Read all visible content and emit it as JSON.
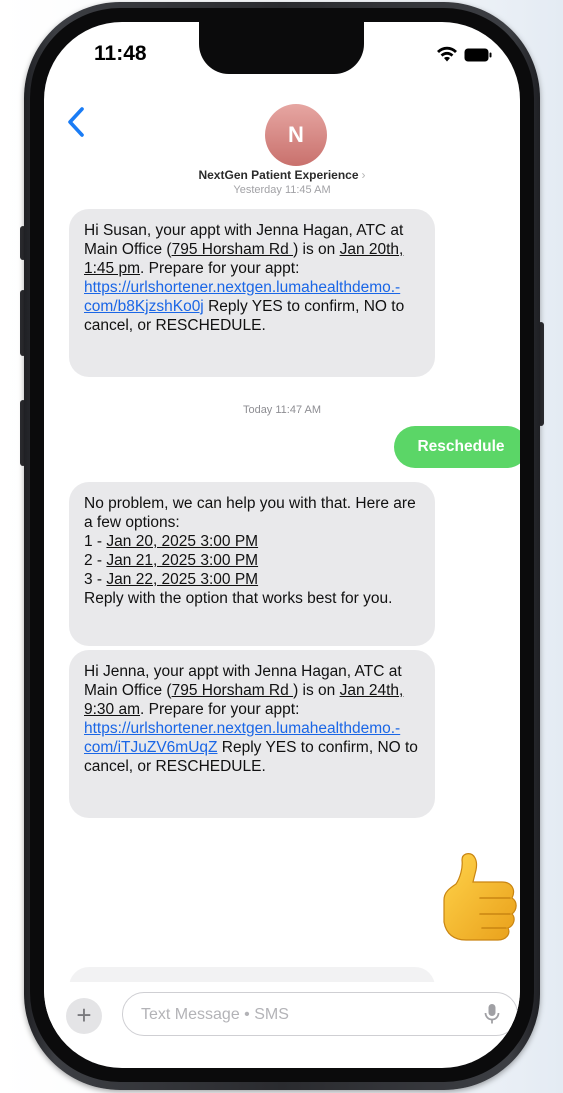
{
  "status_bar": {
    "time": "11:48",
    "icons": [
      "wifi-icon",
      "battery-icon"
    ]
  },
  "header": {
    "back_icon": "chevron-left-icon",
    "avatar_initial": "N",
    "contact_name": "NextGen Patient Experience",
    "contact_chevron": "›"
  },
  "timestamps": {
    "yesterday": "Yesterday 11:45 AM",
    "today": "Today 11:47 AM"
  },
  "messages": [
    {
      "direction": "incoming",
      "segments": [
        {
          "t": "Hi Susan, your appt with Jenna Hagan, ATC at Main Office ("
        },
        {
          "t": "795 Horsham Rd ",
          "u": true
        },
        {
          "t": ") is on "
        },
        {
          "t": "Jan 20th, 1:45 pm",
          "u": true
        },
        {
          "t": ". Prepare for your appt: "
        },
        {
          "t": "https://urlshortener.nextgen.lumahealthdemo.-com/b8KjzshKo0j",
          "link": true
        },
        {
          "t": " Reply YES to confirm, NO to cancel, or RESCHEDULE."
        }
      ]
    },
    {
      "direction": "outgoing",
      "text": "Reschedule"
    },
    {
      "direction": "incoming",
      "segments": [
        {
          "t": "No problem, we can help you with that. Here are a few options:"
        },
        {
          "br": true
        },
        {
          "t": "1 - "
        },
        {
          "t": "Jan 20, 2025 3:00 PM",
          "u": true
        },
        {
          "br": true
        },
        {
          "t": "2 - "
        },
        {
          "t": "Jan 21, 2025 3:00 PM",
          "u": true
        },
        {
          "br": true
        },
        {
          "t": "3 - "
        },
        {
          "t": "Jan 22, 2025 3:00 PM",
          "u": true
        },
        {
          "br": true
        },
        {
          "t": "Reply with the option that works best for you."
        }
      ]
    },
    {
      "direction": "incoming",
      "segments": [
        {
          "t": "Hi Jenna, your appt with Jenna Hagan, ATC at Main Office ("
        },
        {
          "t": "795 Horsham Rd ",
          "u": true
        },
        {
          "t": ") is on "
        },
        {
          "t": "Jan 24th, 9:30 am",
          "u": true
        },
        {
          "t": ". Prepare for your appt: "
        },
        {
          "t": "https://urlshortener.nextgen.lumahealthdemo.-com/iTJuZV6mUqZ",
          "link": true
        },
        {
          "t": " Reply YES to confirm, NO to cancel, or RESCHEDULE."
        }
      ]
    },
    {
      "direction": "outgoing",
      "reaction": "thumbs-up-emoji"
    }
  ],
  "compose": {
    "plus_label": "+",
    "placeholder": "Text Message • SMS",
    "value": "",
    "mic_icon": "microphone-icon"
  },
  "colors": {
    "incoming_bubble": "#e9e9eb",
    "outgoing_bubble": "#5bd667",
    "link": "#1a66e6",
    "accent_blue": "#1a7cf5",
    "avatar": "#d48a86"
  }
}
